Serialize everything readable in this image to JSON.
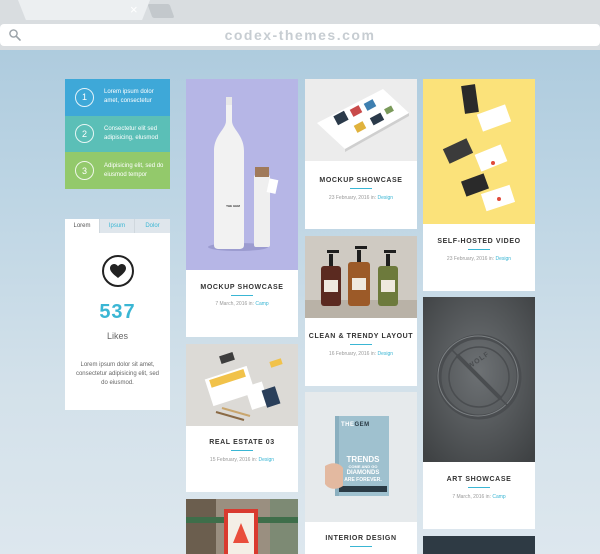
{
  "browser": {
    "url": "codex-themes.com",
    "tab_close": "×"
  },
  "colors": {
    "accent": "#3ab6d4",
    "step1": "#3ea8d8",
    "step2": "#5bbfb7",
    "step3": "#93c96b"
  },
  "steps": [
    {
      "number": "1",
      "text": "Lorem ipsum dolor amet, consectetur"
    },
    {
      "number": "2",
      "text": "Consectetur elit sed adipisicing, elusmod"
    },
    {
      "number": "3",
      "text": "Adipisicing elit, sed do eiusmod tempor"
    }
  ],
  "likes_widget": {
    "tabs": [
      "Lorem",
      "Ipsum",
      "Dolor"
    ],
    "count": "537",
    "label": "Likes",
    "text": "Lorem ipsum dolor sit amet, consectetur adipisicing elit, sed do eiusmod.",
    "icon": "heart-icon"
  },
  "cards": [
    {
      "title": "MOCKUP SHOWCASE",
      "date": "7 March, 2016 in:",
      "category": "Camp"
    },
    {
      "title": "REAL ESTATE 03",
      "date": "15 February, 2016 in:",
      "category": "Design"
    },
    {
      "title": "MOCKUP SHOWCASE",
      "date": "23 February, 2016 in:",
      "category": "Design"
    },
    {
      "title": "CLEAN & TRENDY LAYOUT",
      "date": "16 February, 2016 in:",
      "category": "Design"
    },
    {
      "title": "INTERIOR DESIGN",
      "date": "",
      "category": ""
    },
    {
      "title": "SELF-HOSTED VIDEO",
      "date": "23 February, 2016 in:",
      "category": "Design"
    },
    {
      "title": "ART SHOWCASE",
      "date": "7 March, 2016 in:",
      "category": "Camp"
    },
    {
      "title": "",
      "date": "",
      "category": ""
    }
  ],
  "book": {
    "brand_left": "THE",
    "brand_right": "GEM",
    "headline_1": "TRENDS",
    "headline_2": "COME AND GO",
    "headline_3": "DIAMONDS",
    "headline_4": "ARE FOREVER."
  },
  "bottle_label": "THE GEM",
  "stamp_text": "WOLF"
}
